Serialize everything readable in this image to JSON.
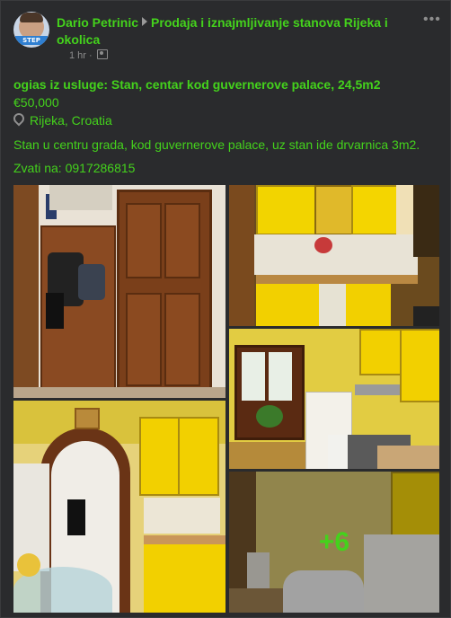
{
  "post": {
    "author": "Dario Petrinic",
    "group": "Prodaja i iznajmljivanje stanova Rijeka i okolica",
    "time": "1 hr",
    "meta_separator": "·",
    "avatar_badge": "STEP",
    "more_icon": "more-dots-icon",
    "title": "ogias iz usluge: Stan, centar kod guvernerove palace, 24,5m2",
    "price": "€50,000",
    "location": "Rijeka, Croatia",
    "description": "Stan u centru grada, kod guvernerove palace, uz stan ide drvarnica 3m2.",
    "phone": "Zvati na: 0917286815",
    "more_photos": "+6"
  },
  "colors": {
    "accent": "#44d21c",
    "background": "#2a2b2d",
    "muted": "#8d8d8d"
  }
}
